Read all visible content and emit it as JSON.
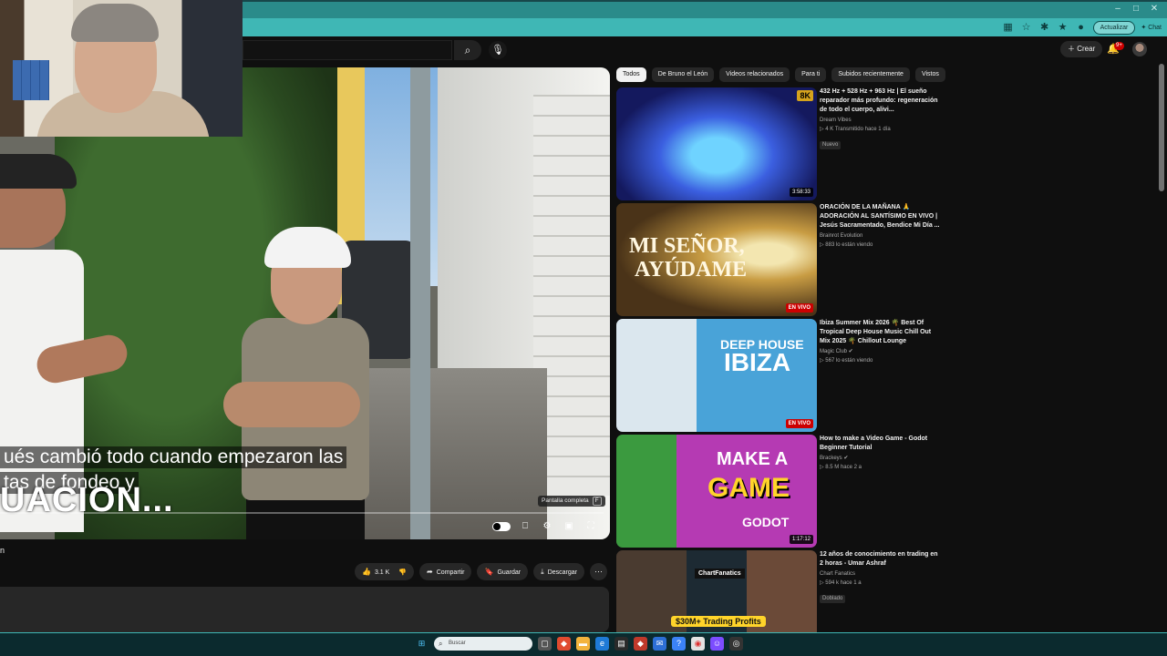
{
  "browser": {
    "update_label": "Actualizar",
    "chat_label": "Chat"
  },
  "youtube_header": {
    "create_label": "Crear",
    "notifications_count": "9+",
    "search_placeholder": ""
  },
  "player": {
    "caption_line1": "ués cambió todo cuando empezaron las",
    "caption_line2": "tas de fondeo y",
    "caption_line3": "UACION...",
    "tooltip_label": "Pantalla completa",
    "tooltip_key": "F",
    "progress_percent": 0
  },
  "video": {
    "title_partial": "n",
    "likes": "3.1 K",
    "share_label": "Compartir",
    "save_label": "Guardar",
    "download_label": "Descargar"
  },
  "chips": [
    "Todos",
    "De Bruno el León",
    "Videos relacionados",
    "Para ti",
    "Subidos recientemente",
    "Vistos"
  ],
  "recommendations": [
    {
      "title": "432 Hz + 528 Hz + 963 Hz | El sueño reparador más profundo: regeneración de todo el cuerpo, alivi...",
      "channel": "Dream Vibes",
      "meta": "▷ 4 K   Transmitido hace 1 día",
      "badge": "Nuevo",
      "duration": "3:58:33",
      "thumb_overlay": "8K"
    },
    {
      "title": "ORACIÓN DE LA MAÑANA 🙏 ADORACIÓN AL SANTÍSIMO EN VIVO | Jesús Sacramentado, Bendice Mi Día ...",
      "channel": "Brainrot Evolution",
      "meta": "▷ 883 lo están viendo",
      "live": "EN VIVO",
      "thumb_line1": "MI SEÑOR,",
      "thumb_line2": "AYÚDAME"
    },
    {
      "title": "Ibiza Summer Mix 2026 🌴 Best Of Tropical Deep House Music Chill Out Mix 2025 🌴 Chillout Lounge",
      "channel": "Magic Club ✔",
      "meta": "▷ 567 lo están viendo",
      "live": "EN VIVO",
      "thumb_line1": "DEEP HOUSE",
      "thumb_line2": "IBIZA"
    },
    {
      "title": "How to make a Video Game - Godot Beginner Tutorial",
      "channel": "Brackeys ✔",
      "meta": "▷ 8.5 M   hace 2 a",
      "duration": "1:17:12",
      "thumb_line1": "MAKE A",
      "thumb_line2": "GAME",
      "thumb_line3": "GODOT"
    },
    {
      "title": "12 años de conocimiento en trading en 2 horas - Umar Ashraf",
      "channel": "Chart Fanatics",
      "meta": "▷ 594 k   hace 1 a",
      "badge": "Doblado",
      "thumb_line1": "ChartFanatics",
      "thumb_line2": "$30M+ Trading Profits"
    }
  ],
  "taskbar": {
    "search_placeholder": "Buscar"
  }
}
